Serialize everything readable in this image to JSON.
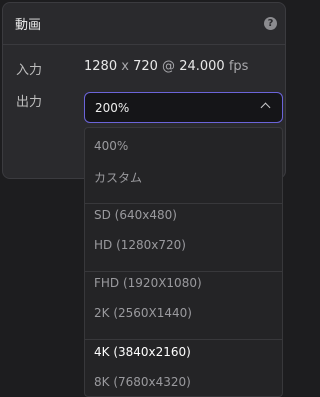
{
  "panel": {
    "title": "動画",
    "help_glyph": "?"
  },
  "input": {
    "label": "入力",
    "width": "1280",
    "x_sep": "x",
    "height": "720",
    "at_sep": "@",
    "fps_value": "24.000",
    "fps_unit": "fps"
  },
  "output": {
    "label": "出力",
    "selected": "200%"
  },
  "dropdown": {
    "options": [
      {
        "label": "400%"
      },
      {
        "label": "カスタム"
      },
      {
        "label": "SD (640x480)"
      },
      {
        "label": "HD (1280x720)"
      },
      {
        "label": "FHD (1920X1080)"
      },
      {
        "label": "2K (2560X1440)"
      },
      {
        "label": "4K (3840x2160)",
        "active": true
      },
      {
        "label": "8K (7680x4320)"
      }
    ]
  }
}
